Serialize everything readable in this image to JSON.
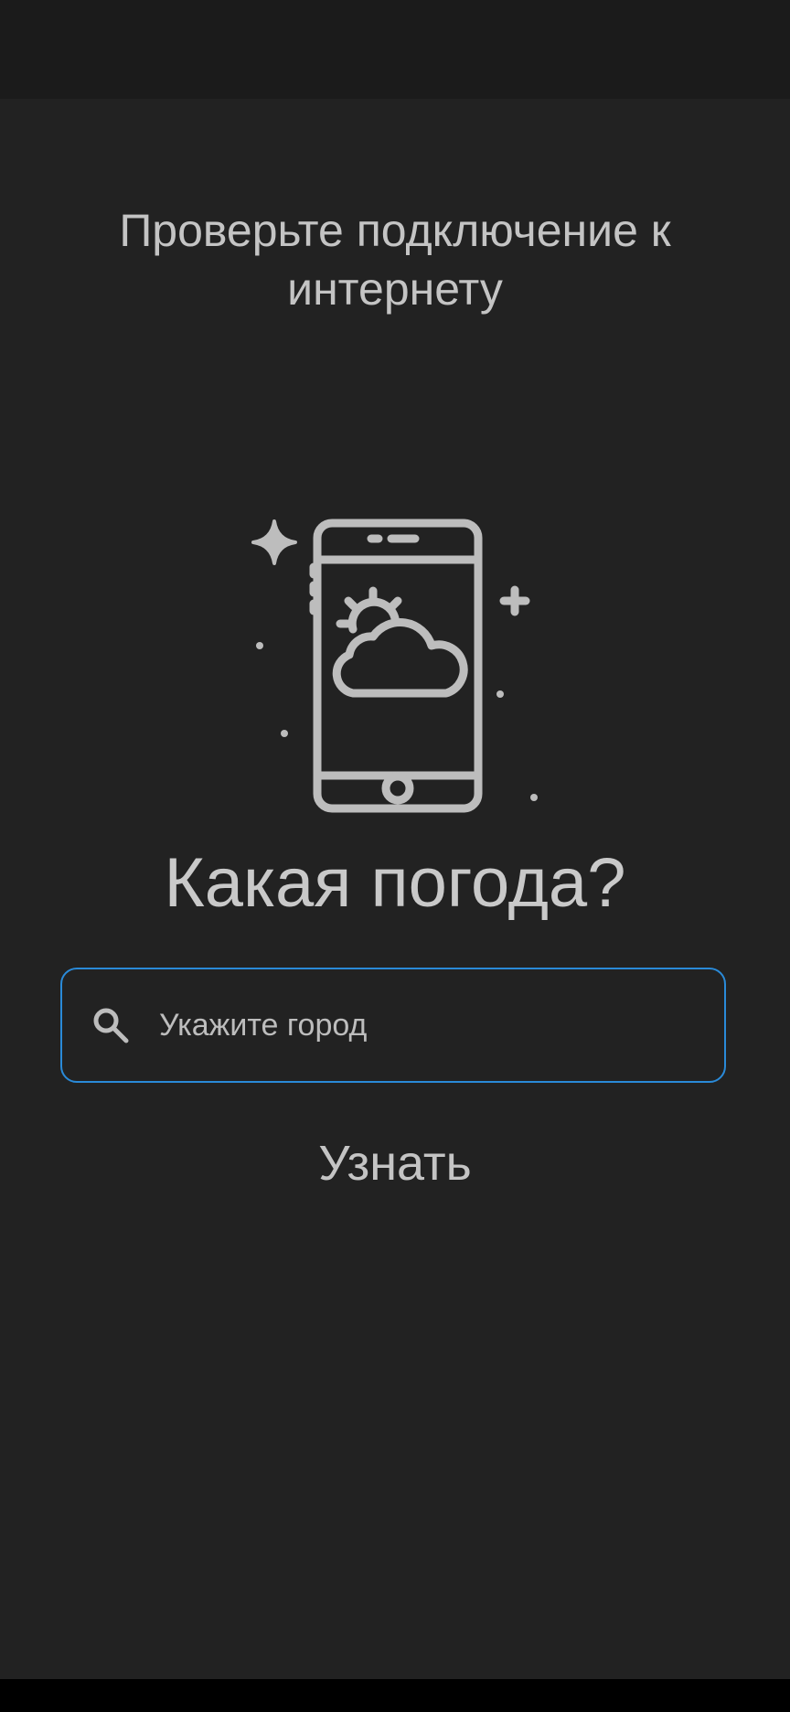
{
  "error": {
    "message": "Проверьте подключение к интернету"
  },
  "illustration": {
    "icon": "phone-weather-icon"
  },
  "main": {
    "title": "Какая погода?"
  },
  "search": {
    "placeholder": "Укажите город",
    "value": "",
    "icon": "search-icon"
  },
  "actions": {
    "submit_label": "Узнать"
  },
  "colors": {
    "background": "#222222",
    "status_bar": "#1b1b1b",
    "text": "#c4c4c4",
    "accent": "#2a8ad8",
    "icon_stroke": "#bdbdbd"
  }
}
